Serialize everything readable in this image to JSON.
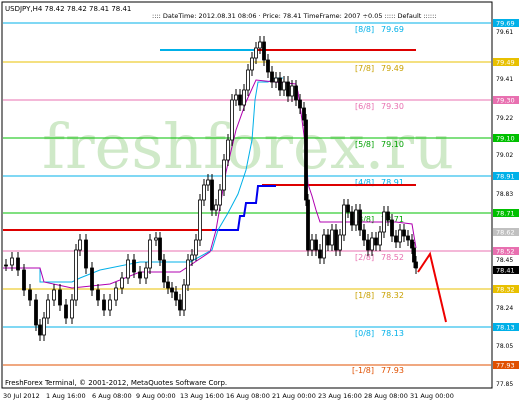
{
  "window": {
    "symbol_header": "USDJPY,H4  78.42 78.42 78.41 78.41",
    "info_header": ":::: DateTime: 2012.08.31 08:06  ·  Price: 78.41   TimeFrame: 2007 ÷0.05   ::::: Default   ::::::",
    "watermark": "freshforex.ru",
    "copyright": "FreshForex Terminal, © 2001-2012, MetaQuotes Software Corp."
  },
  "colors": {
    "background": "#ffffff",
    "candle": "#000000",
    "cyan_band": "#00b0e8",
    "blue_band": "#0000ee",
    "magenta_band": "#b000b0",
    "red_line": "#dd0000",
    "watermark": "#c8e8c0"
  },
  "price_axis": {
    "ticks": [
      "79.69",
      "79.49",
      "79.30",
      "79.10",
      "78.91",
      "78.71",
      "78.52",
      "78.45",
      "78.41",
      "78.32",
      "78.13",
      "77.93",
      "79.61",
      "79.41",
      "79.22",
      "79.02",
      "78.83",
      "78.63",
      "78.44",
      "78.24",
      "78.05",
      "77.85"
    ]
  },
  "time_axis": {
    "labels": [
      "30 Jul 2012",
      "1 Aug 16:00",
      "6 Aug 08:00",
      "9 Aug 00:00",
      "13 Aug 16:00",
      "16 Aug 08:00",
      "21 Aug 00:00",
      "23 Aug 16:00",
      "28 Aug 08:00",
      "31 Aug 00:00"
    ]
  },
  "murrey_levels": [
    {
      "label": "[8/8]",
      "value": "79.69",
      "color": "#00b0e8",
      "badge": "79.69"
    },
    {
      "label": "[7/8]",
      "value": "79.49",
      "color": "#e8c000",
      "badge": "79.49"
    },
    {
      "label": "[6/8]",
      "value": "79.30",
      "color": "#e870b0",
      "badge": "79.30"
    },
    {
      "label": "[5/8]",
      "value": "79.10",
      "color": "#00c000",
      "badge": "79.10"
    },
    {
      "label": "[4/8]",
      "value": "78.91",
      "color": "#00b0e8",
      "badge": "78.91"
    },
    {
      "label": "[3/8]",
      "value": "78.71",
      "color": "#00c000",
      "badge": "78.71"
    },
    {
      "label": "[2/8]",
      "value": "78.52",
      "color": "#e870b0",
      "badge": "78.52"
    },
    {
      "label": "[1/8]",
      "value": "78.32",
      "color": "#e8c000",
      "badge": "78.32"
    },
    {
      "label": "[0/8]",
      "value": "78.13",
      "color": "#00b0e8",
      "badge": "78.13"
    },
    {
      "label": "[-1/8]",
      "value": "77.93",
      "color": "#e05000",
      "badge": "77.93"
    }
  ],
  "current_price": {
    "value": "78.41",
    "prev_value": "78.62"
  }
}
